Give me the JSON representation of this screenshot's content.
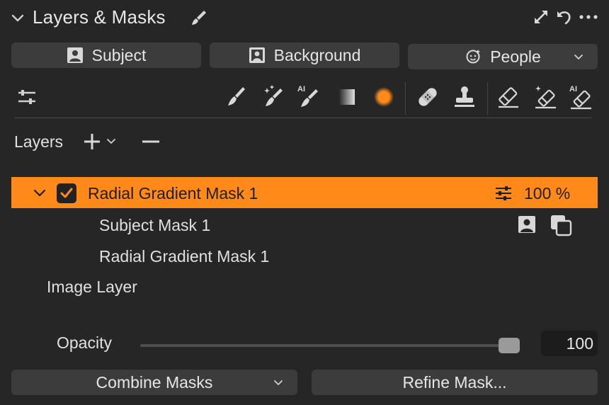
{
  "header": {
    "title": "Layers & Masks"
  },
  "quick_masks": {
    "subject": "Subject",
    "background": "Background",
    "people": "People"
  },
  "toolbar": {
    "ai_label": "AI"
  },
  "layers": {
    "label": "Layers",
    "items": [
      {
        "name": "Radial Gradient Mask 1",
        "opacity": "100 %",
        "checked": true,
        "selected": true,
        "children": [
          {
            "name": "Subject Mask 1"
          },
          {
            "name": "Radial Gradient Mask 1"
          }
        ]
      },
      {
        "name": "Image Layer"
      }
    ]
  },
  "opacity": {
    "label": "Opacity",
    "value": "100",
    "fraction": 1.0
  },
  "footer": {
    "combine": "Combine Masks",
    "refine": "Refine Mask..."
  },
  "colors": {
    "accent": "#ff8a1a",
    "panel": "#262626",
    "button": "#3c3c3c"
  }
}
